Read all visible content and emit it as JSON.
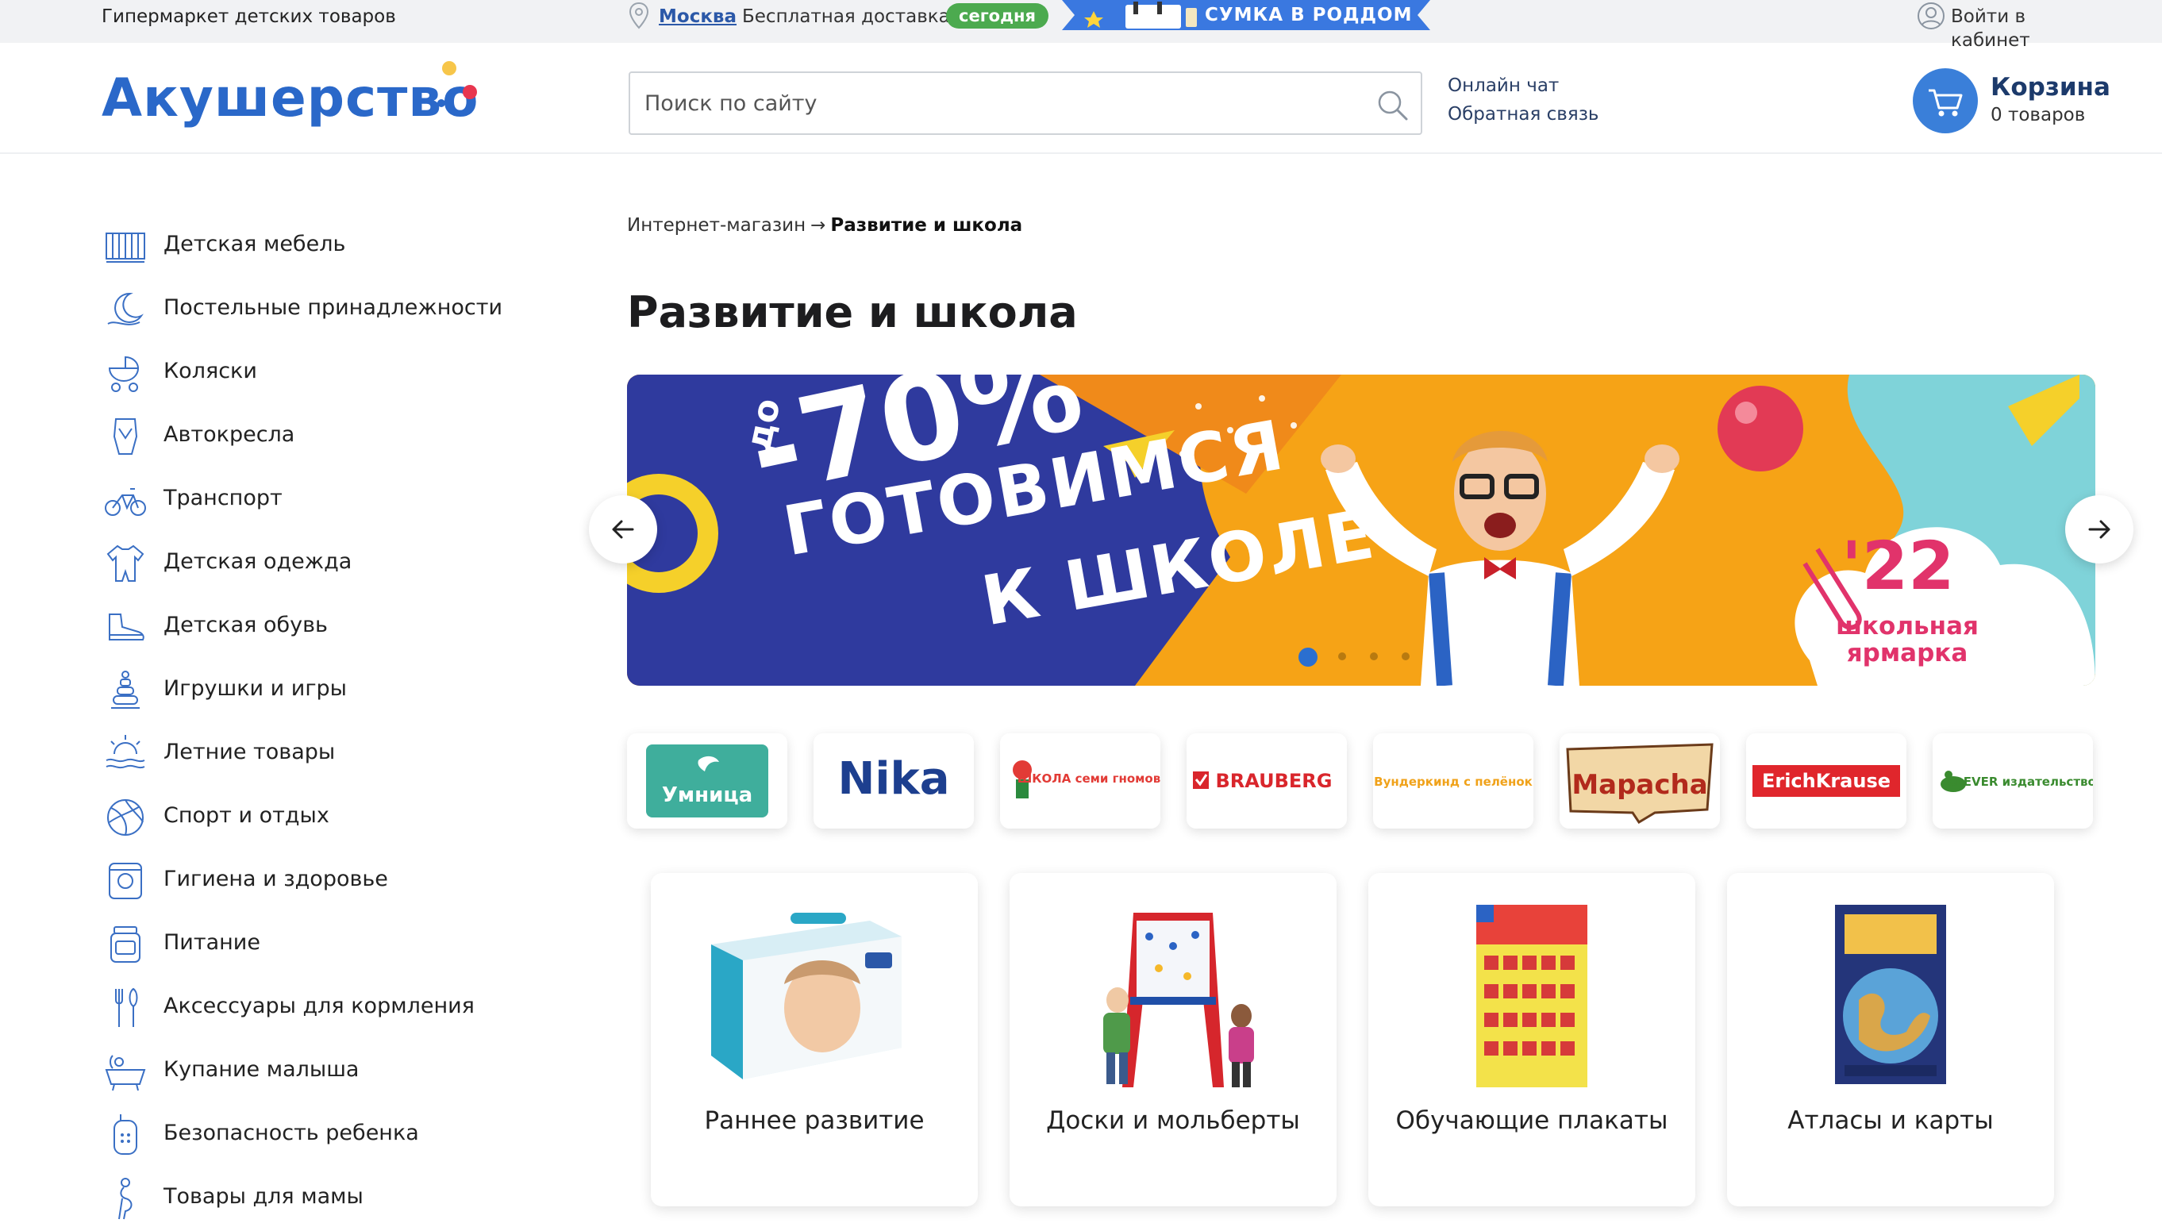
{
  "topbar": {
    "tagline": "Гипермаркет детских товаров",
    "city": "Москва",
    "delivery_label": "Бесплатная доставка:",
    "delivery_badge": "сегодня",
    "promo_ribbon": "СУМКА В РОДДОМ",
    "login": "Войти в кабинет"
  },
  "header": {
    "logo": "Акушерство",
    "search_placeholder": "Поиск по сайту",
    "link_chat": "Онлайн чат",
    "link_feedback": "Обратная связь",
    "cart_title": "Корзина",
    "cart_count": "0 товаров"
  },
  "sidebar": {
    "items": [
      {
        "label": "Детская мебель",
        "icon": "crib-icon"
      },
      {
        "label": "Постельные принадлежности",
        "icon": "bedding-moon-icon"
      },
      {
        "label": "Коляски",
        "icon": "stroller-icon"
      },
      {
        "label": "Автокресла",
        "icon": "car-seat-icon"
      },
      {
        "label": "Транспорт",
        "icon": "bicycle-icon"
      },
      {
        "label": "Детская одежда",
        "icon": "bodysuit-icon"
      },
      {
        "label": "Детская обувь",
        "icon": "shoe-icon"
      },
      {
        "label": "Игрушки и игры",
        "icon": "pyramid-toy-icon"
      },
      {
        "label": "Летние товары",
        "icon": "sun-icon"
      },
      {
        "label": "Спорт и отдых",
        "icon": "ball-icon"
      },
      {
        "label": "Гигиена и здоровье",
        "icon": "diaper-pack-icon"
      },
      {
        "label": "Питание",
        "icon": "baby-food-jar-icon"
      },
      {
        "label": "Аксессуары для кормления",
        "icon": "cutlery-icon"
      },
      {
        "label": "Купание малыша",
        "icon": "bathtub-icon"
      },
      {
        "label": "Безопасность ребенка",
        "icon": "baby-monitor-icon"
      },
      {
        "label": "Товары для мамы",
        "icon": "pregnant-woman-icon"
      }
    ]
  },
  "breadcrumb": {
    "root": "Интернет-магазин",
    "separator": "→",
    "current": "Развитие и школа"
  },
  "page_title": "Развитие и школа",
  "banner": {
    "discount_prefix": "до",
    "discount": "-70%",
    "headline_1": "ГОТОВИМСЯ",
    "headline_2": "К ШКОЛЕ",
    "year": "'22",
    "fair": "школьная ярмарка",
    "slides_total": 4,
    "active_slide": 1
  },
  "brands": [
    {
      "name": "Умница",
      "color": "#2f9c8a"
    },
    {
      "name": "Nika",
      "color": "#1d3f8f"
    },
    {
      "name": "ШКОЛА семи гномов",
      "color": "#e23b36"
    },
    {
      "name": "BRAUBERG",
      "color": "#d9262c"
    },
    {
      "name": "Вундеркинд с пелёнок",
      "color": "#f0a21a"
    },
    {
      "name": "Мараcha",
      "color": "#b22a1c"
    },
    {
      "name": "ErichKrause",
      "color": "#e0262c"
    },
    {
      "name": "CLEVER издательство",
      "color": "#3a8b2f"
    }
  ],
  "categories": [
    {
      "label": "Раннее развитие"
    },
    {
      "label": "Доски и мольберты"
    },
    {
      "label": "Обучающие плакаты"
    },
    {
      "label": "Атласы и карты"
    }
  ],
  "colors": {
    "brand_blue": "#2a68c9",
    "accent_green": "#4caa4f",
    "banner_orange": "#f6a316",
    "banner_navy": "#2f3a9e",
    "banner_pink": "#e1336b"
  }
}
